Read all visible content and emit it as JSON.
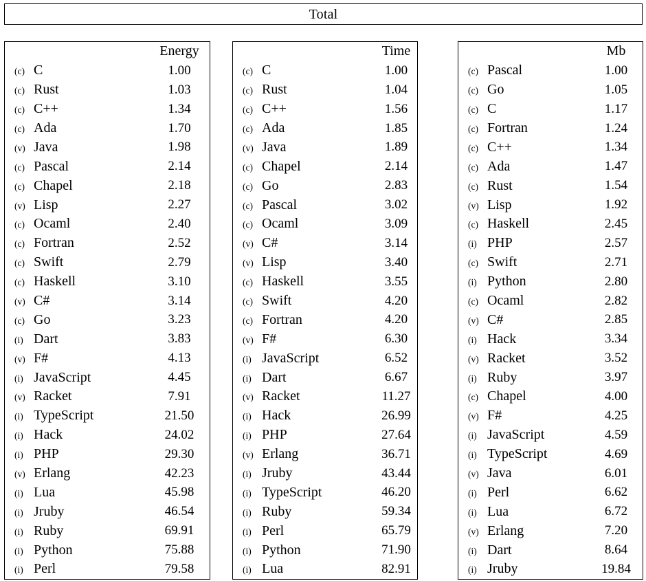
{
  "page": {
    "title": "Total"
  },
  "tables": [
    {
      "id": "energy",
      "name": "energy-table",
      "blank_header": "",
      "metric_header": "Energy",
      "rows": [
        {
          "tag": "(c)",
          "lang": "C",
          "value": "1.00"
        },
        {
          "tag": "(c)",
          "lang": "Rust",
          "value": "1.03"
        },
        {
          "tag": "(c)",
          "lang": "C++",
          "value": "1.34"
        },
        {
          "tag": "(c)",
          "lang": "Ada",
          "value": "1.70"
        },
        {
          "tag": "(v)",
          "lang": "Java",
          "value": "1.98"
        },
        {
          "tag": "(c)",
          "lang": "Pascal",
          "value": "2.14"
        },
        {
          "tag": "(c)",
          "lang": "Chapel",
          "value": "2.18"
        },
        {
          "tag": "(v)",
          "lang": "Lisp",
          "value": "2.27"
        },
        {
          "tag": "(c)",
          "lang": "Ocaml",
          "value": "2.40"
        },
        {
          "tag": "(c)",
          "lang": "Fortran",
          "value": "2.52"
        },
        {
          "tag": "(c)",
          "lang": "Swift",
          "value": "2.79"
        },
        {
          "tag": "(c)",
          "lang": "Haskell",
          "value": "3.10"
        },
        {
          "tag": "(v)",
          "lang": "C#",
          "value": "3.14"
        },
        {
          "tag": "(c)",
          "lang": "Go",
          "value": "3.23"
        },
        {
          "tag": "(i)",
          "lang": "Dart",
          "value": "3.83"
        },
        {
          "tag": "(v)",
          "lang": "F#",
          "value": "4.13"
        },
        {
          "tag": "(i)",
          "lang": "JavaScript",
          "value": "4.45"
        },
        {
          "tag": "(v)",
          "lang": "Racket",
          "value": "7.91"
        },
        {
          "tag": "(i)",
          "lang": "TypeScript",
          "value": "21.50"
        },
        {
          "tag": "(i)",
          "lang": "Hack",
          "value": "24.02"
        },
        {
          "tag": "(i)",
          "lang": "PHP",
          "value": "29.30"
        },
        {
          "tag": "(v)",
          "lang": "Erlang",
          "value": "42.23"
        },
        {
          "tag": "(i)",
          "lang": "Lua",
          "value": "45.98"
        },
        {
          "tag": "(i)",
          "lang": "Jruby",
          "value": "46.54"
        },
        {
          "tag": "(i)",
          "lang": "Ruby",
          "value": "69.91"
        },
        {
          "tag": "(i)",
          "lang": "Python",
          "value": "75.88"
        },
        {
          "tag": "(i)",
          "lang": "Perl",
          "value": "79.58"
        }
      ]
    },
    {
      "id": "time",
      "name": "time-table",
      "blank_header": "",
      "metric_header": "Time",
      "rows": [
        {
          "tag": "(c)",
          "lang": "C",
          "value": "1.00"
        },
        {
          "tag": "(c)",
          "lang": "Rust",
          "value": "1.04"
        },
        {
          "tag": "(c)",
          "lang": "C++",
          "value": "1.56"
        },
        {
          "tag": "(c)",
          "lang": "Ada",
          "value": "1.85"
        },
        {
          "tag": "(v)",
          "lang": "Java",
          "value": "1.89"
        },
        {
          "tag": "(c)",
          "lang": "Chapel",
          "value": "2.14"
        },
        {
          "tag": "(c)",
          "lang": "Go",
          "value": "2.83"
        },
        {
          "tag": "(c)",
          "lang": "Pascal",
          "value": "3.02"
        },
        {
          "tag": "(c)",
          "lang": "Ocaml",
          "value": "3.09"
        },
        {
          "tag": "(v)",
          "lang": "C#",
          "value": "3.14"
        },
        {
          "tag": "(v)",
          "lang": "Lisp",
          "value": "3.40"
        },
        {
          "tag": "(c)",
          "lang": "Haskell",
          "value": "3.55"
        },
        {
          "tag": "(c)",
          "lang": "Swift",
          "value": "4.20"
        },
        {
          "tag": "(c)",
          "lang": "Fortran",
          "value": "4.20"
        },
        {
          "tag": "(v)",
          "lang": "F#",
          "value": "6.30"
        },
        {
          "tag": "(i)",
          "lang": "JavaScript",
          "value": "6.52"
        },
        {
          "tag": "(i)",
          "lang": "Dart",
          "value": "6.67"
        },
        {
          "tag": "(v)",
          "lang": "Racket",
          "value": "11.27"
        },
        {
          "tag": "(i)",
          "lang": "Hack",
          "value": "26.99"
        },
        {
          "tag": "(i)",
          "lang": "PHP",
          "value": "27.64"
        },
        {
          "tag": "(v)",
          "lang": "Erlang",
          "value": "36.71"
        },
        {
          "tag": "(i)",
          "lang": "Jruby",
          "value": "43.44"
        },
        {
          "tag": "(i)",
          "lang": "TypeScript",
          "value": "46.20"
        },
        {
          "tag": "(i)",
          "lang": "Ruby",
          "value": "59.34"
        },
        {
          "tag": "(i)",
          "lang": "Perl",
          "value": "65.79"
        },
        {
          "tag": "(i)",
          "lang": "Python",
          "value": "71.90"
        },
        {
          "tag": "(i)",
          "lang": "Lua",
          "value": "82.91"
        }
      ]
    },
    {
      "id": "mb",
      "name": "memory-table",
      "blank_header": "",
      "metric_header": "Mb",
      "rows": [
        {
          "tag": "(c)",
          "lang": "Pascal",
          "value": "1.00"
        },
        {
          "tag": "(c)",
          "lang": "Go",
          "value": "1.05"
        },
        {
          "tag": "(c)",
          "lang": "C",
          "value": "1.17"
        },
        {
          "tag": "(c)",
          "lang": "Fortran",
          "value": "1.24"
        },
        {
          "tag": "(c)",
          "lang": "C++",
          "value": "1.34"
        },
        {
          "tag": "(c)",
          "lang": "Ada",
          "value": "1.47"
        },
        {
          "tag": "(c)",
          "lang": "Rust",
          "value": "1.54"
        },
        {
          "tag": "(v)",
          "lang": "Lisp",
          "value": "1.92"
        },
        {
          "tag": "(c)",
          "lang": "Haskell",
          "value": "2.45"
        },
        {
          "tag": "(i)",
          "lang": "PHP",
          "value": "2.57"
        },
        {
          "tag": "(c)",
          "lang": "Swift",
          "value": "2.71"
        },
        {
          "tag": "(i)",
          "lang": "Python",
          "value": "2.80"
        },
        {
          "tag": "(c)",
          "lang": "Ocaml",
          "value": "2.82"
        },
        {
          "tag": "(v)",
          "lang": "C#",
          "value": "2.85"
        },
        {
          "tag": "(i)",
          "lang": "Hack",
          "value": "3.34"
        },
        {
          "tag": "(v)",
          "lang": "Racket",
          "value": "3.52"
        },
        {
          "tag": "(i)",
          "lang": "Ruby",
          "value": "3.97"
        },
        {
          "tag": "(c)",
          "lang": "Chapel",
          "value": "4.00"
        },
        {
          "tag": "(v)",
          "lang": "F#",
          "value": "4.25"
        },
        {
          "tag": "(i)",
          "lang": "JavaScript",
          "value": "4.59"
        },
        {
          "tag": "(i)",
          "lang": "TypeScript",
          "value": "4.69"
        },
        {
          "tag": "(v)",
          "lang": "Java",
          "value": "6.01"
        },
        {
          "tag": "(i)",
          "lang": "Perl",
          "value": "6.62"
        },
        {
          "tag": "(i)",
          "lang": "Lua",
          "value": "6.72"
        },
        {
          "tag": "(v)",
          "lang": "Erlang",
          "value": "7.20"
        },
        {
          "tag": "(i)",
          "lang": "Dart",
          "value": "8.64"
        },
        {
          "tag": "(i)",
          "lang": "Jruby",
          "value": "19.84"
        }
      ]
    }
  ]
}
